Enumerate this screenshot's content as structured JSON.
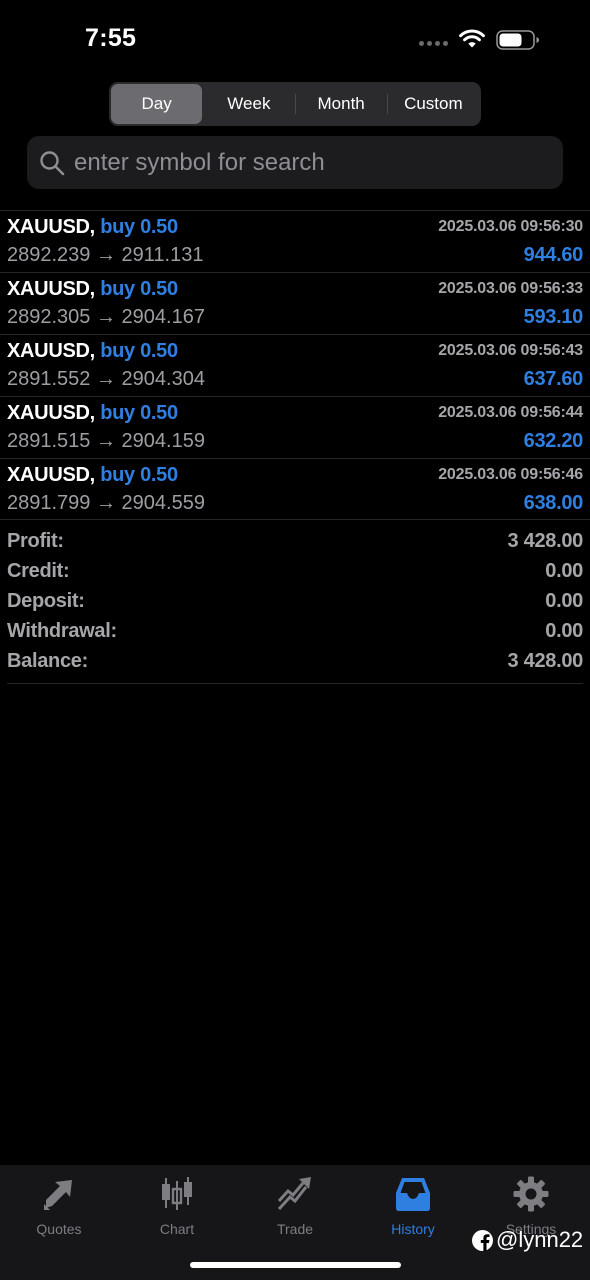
{
  "status_bar": {
    "time": "7:55"
  },
  "segmented": {
    "options": [
      "Day",
      "Week",
      "Month",
      "Custom"
    ],
    "selected": "Day"
  },
  "search": {
    "placeholder": "enter symbol for search",
    "value": ""
  },
  "deals": [
    {
      "symbol": "XAUUSD,",
      "direction": "buy 0.50",
      "time": "2025.03.06 09:56:30",
      "prices": "2892.239 → 2911.131",
      "profit": "944.60"
    },
    {
      "symbol": "XAUUSD,",
      "direction": "buy 0.50",
      "time": "2025.03.06 09:56:33",
      "prices": "2892.305 → 2904.167",
      "profit": "593.10"
    },
    {
      "symbol": "XAUUSD,",
      "direction": "buy 0.50",
      "time": "2025.03.06 09:56:43",
      "prices": "2891.552 → 2904.304",
      "profit": "637.60"
    },
    {
      "symbol": "XAUUSD,",
      "direction": "buy 0.50",
      "time": "2025.03.06 09:56:44",
      "prices": "2891.515 → 2904.159",
      "profit": "632.20"
    },
    {
      "symbol": "XAUUSD,",
      "direction": "buy 0.50",
      "time": "2025.03.06 09:56:46",
      "prices": "2891.799 → 2904.559",
      "profit": "638.00"
    }
  ],
  "summary": [
    {
      "label": "Profit:",
      "value": "3 428.00"
    },
    {
      "label": "Credit:",
      "value": "0.00"
    },
    {
      "label": "Deposit:",
      "value": "0.00"
    },
    {
      "label": "Withdrawal:",
      "value": "0.00"
    },
    {
      "label": "Balance:",
      "value": "3 428.00"
    }
  ],
  "tabbar": {
    "items": [
      {
        "label": "Quotes",
        "icon": "quotes-icon"
      },
      {
        "label": "Chart",
        "icon": "candlestick-chart-icon"
      },
      {
        "label": "Trade",
        "icon": "trade-icon"
      },
      {
        "label": "History",
        "icon": "inbox-tray-icon"
      },
      {
        "label": "Settings",
        "icon": "gear-icon"
      }
    ],
    "active": "History"
  },
  "watermark": {
    "text": "@lynn22",
    "icon": "facebook-icon"
  },
  "colors": {
    "accent": "#2f7fe0",
    "background": "#000000",
    "muted": "#a6a6aa"
  }
}
